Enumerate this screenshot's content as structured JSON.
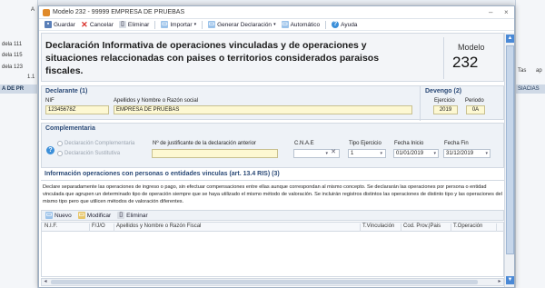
{
  "window": {
    "title": "Modelo 232 - 99999 EMPRESA DE PRUEBAS",
    "minimize": "–",
    "close": "×"
  },
  "background": {
    "left_items": [
      "dela 111",
      "dela 115",
      "dela 123",
      "1.1"
    ],
    "left_highlight": "A DE PR",
    "left_tab_a": "A",
    "right_items": [
      "Tas",
      "ap"
    ],
    "right_highlight": "SIACIAS"
  },
  "toolbar": {
    "guardar": "Guardar",
    "cancelar": "Cancelar",
    "eliminar": "Eliminar",
    "importar": "Importar",
    "generar": "Generar Declaración",
    "automatico": "Automático",
    "ayuda": "Ayuda"
  },
  "header": {
    "title": "Declaración Informativa de operaciones vinculadas y de operaciones y situaciones relaccionadas con paises o territorios considerados paraisos fiscales.",
    "modelo_label": "Modelo",
    "modelo_number": "232"
  },
  "declarante": {
    "title": "Declarante (1)",
    "nif_label": "NIF",
    "nif_value": "12345678Z",
    "nombre_label": "Apellidos y Nombre o Razón social",
    "nombre_value": "EMPRESA DE PRUEBAS"
  },
  "devengo": {
    "title": "Devengo (2)",
    "ejercicio_label": "Ejercicio",
    "ejercicio_value": "2019",
    "periodo_label": "Periodo",
    "periodo_value": "0A"
  },
  "complementaria": {
    "title": "Complementaria",
    "radio_complementaria": "Declaración Complementaria",
    "radio_sustitutiva": "Declaración Sustitutiva",
    "justificante_label": "Nº de justificante de la declaración anterior",
    "cnae_label": "C.N.A.E",
    "tipo_ejercicio_label": "Tipo Ejercicio",
    "tipo_ejercicio_value": "1",
    "fecha_inicio_label": "Fecha Inicio",
    "fecha_inicio_value": "01/01/2019",
    "fecha_fin_label": "Fecha Fin",
    "fecha_fin_value": "31/12/2019"
  },
  "operaciones": {
    "title": "Información operaciones con personas o entidades vinculas (art. 13.4 RIS) (3)",
    "description": "Declare separadamente las operaciones de ingreso o pago, sin efectuar compensaciones entre ellas aunque correspondan al mismo concepto. Se declararán las operaciones por persona o entidad vinculada que agrupen un determinado tipo de operación siempre que se haya utilizado el mismo método de valoración. Se incluirán registros distintos las operaciones de distinto tipo y las operaciones del mismo tipo pero que utilicen métodos de valoración diferentes."
  },
  "grid": {
    "nuevo": "Nuevo",
    "modificar": "Modificar",
    "eliminar": "Eliminar",
    "columns": [
      "N.I.F.",
      "F/J/O",
      "Apellidos y Nombre o Razón Fiscal",
      "T.Vinculación",
      "Cod. Prov.|Pais",
      "T.Operación"
    ]
  }
}
